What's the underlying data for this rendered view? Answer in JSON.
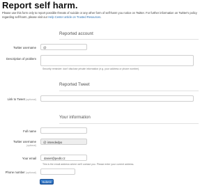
{
  "page": {
    "title": "Report self harm.",
    "intro_text": "Please use this form only to report possible threats of suicide or any other form of self-harm you notice on Twitter. For further information on Twitter's policy regarding self-harm, please visit our ",
    "intro_link": "Help Center article on Trusted Resources",
    "intro_end": "."
  },
  "sections": {
    "reported_account": "Reported account",
    "reported_tweet": "Reported Tweet",
    "your_information": "Your information"
  },
  "fields": {
    "twitter_username": {
      "label": "Twitter username",
      "at": "@",
      "value": ""
    },
    "problem_description": {
      "label": "Description of problem",
      "help": "Security reminder: don't disclose private information (e.g. your address or phone number)."
    },
    "link_to_tweet": {
      "label": "Link to Tweet",
      "optional": "(optional)",
      "value": ""
    },
    "full_name": {
      "label": "Full name",
      "value": ""
    },
    "your_twitter_username": {
      "label": "Twitter username",
      "sublabel": "(optional)",
      "at": "@",
      "value": "intendedpo"
    },
    "your_email": {
      "label": "Your email",
      "value": "daniel@pedit.cz",
      "help": "This is the email address where we'll contact you. Please enter your current address."
    },
    "phone_number": {
      "label": "Phone number",
      "optional": "(optional)",
      "value": ""
    }
  },
  "buttons": {
    "submit": "Submit"
  }
}
